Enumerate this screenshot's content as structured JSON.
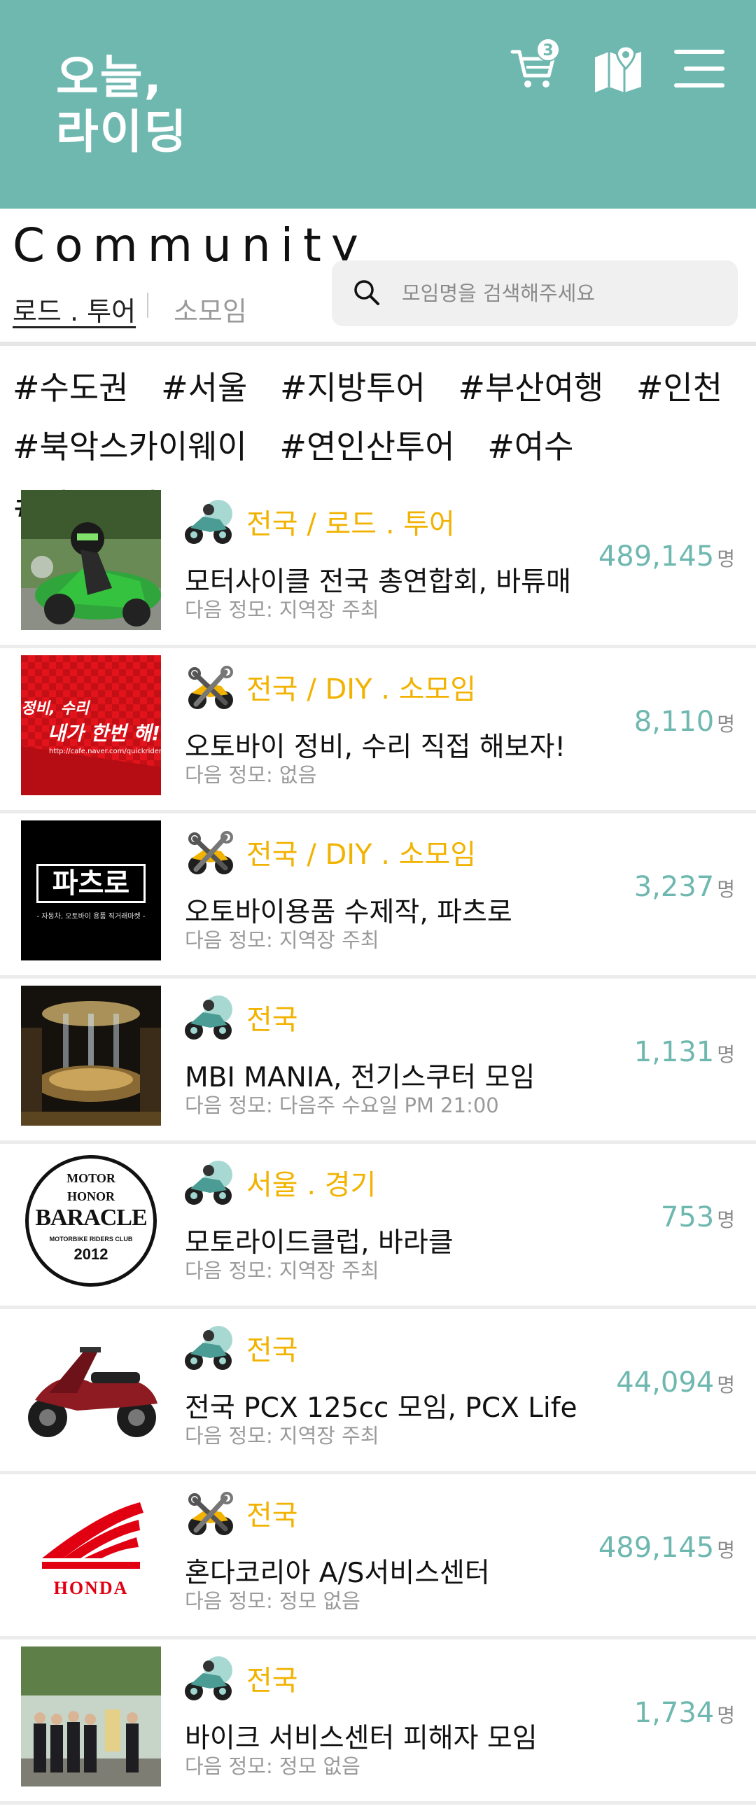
{
  "header": {
    "logo_line1": "오늘,",
    "logo_line2": "라이딩",
    "cart_count": "3",
    "colors": {
      "brand": "#6fb8b0",
      "accent": "#f2b200"
    }
  },
  "community": {
    "title": "Community",
    "tabs": [
      {
        "label": "로드 . 투어"
      },
      {
        "label": "소모임"
      }
    ],
    "search_placeholder": "모임명을 검색해주세요"
  },
  "tags": [
    "#수도권",
    "#서울",
    "#지방투어",
    "#부산여행",
    "#인천",
    "#북악스카이웨이",
    "#연인산투어",
    "#여수",
    "#커플투어"
  ],
  "unit": "명",
  "groups": [
    {
      "category": "전국 / 로드 . 투어",
      "name": "모터사이클 전국 총연합회, 바튜매",
      "next": "다음 정모: 지역장 주최",
      "count": "489,145",
      "icon": "motorcycle-icon",
      "thumb": "racer"
    },
    {
      "category": "전국  / DIY . 소모임",
      "name": "오토바이 정비, 수리 직접 해보자!",
      "next": "다음 정모: 없음",
      "count": "8,110",
      "icon": "tools-icon",
      "thumb": "repair",
      "thumb_text1": "정비, 수리",
      "thumb_text2": "내가 한번 해!",
      "thumb_url": "http://cafe.naver.com/quickrider"
    },
    {
      "category": "전국  / DIY . 소모임",
      "name": "오토바이용품 수제작, 파츠로",
      "next": "다음 정모: 지역장 주최",
      "count": "3,237",
      "icon": "tools-icon",
      "thumb": "partsro",
      "thumb_text1": "파츠로",
      "thumb_text2": "- 자동차, 오토바이 용품 직거래마켓 -"
    },
    {
      "category": "전국",
      "name": "MBI MANIA, 전기스쿠터 모임",
      "next": "다음 정모: 다음주 수요일 PM 21:00",
      "count": "1,131",
      "icon": "motorcycle-icon",
      "thumb": "stage"
    },
    {
      "category": "서울 . 경기",
      "name": "모토라이드클럽, 바라클",
      "next": "다음 정모: 지역장 주최",
      "count": "753",
      "icon": "motorcycle-icon",
      "thumb": "baracle",
      "thumb_text1": "MOTOR",
      "thumb_text2": "HONOR",
      "thumb_text3": "BARACLE",
      "thumb_text4": "MOTORBIKE RIDERS CLUB",
      "thumb_text5": "2012"
    },
    {
      "category": "전국",
      "name": "전국 PCX 125cc 모임, PCX Life",
      "next": "다음 정모: 지역장 주최",
      "count": "44,094",
      "icon": "motorcycle-icon",
      "thumb": "scooter"
    },
    {
      "category": "전국",
      "name": "혼다코리아 A/S서비스센터",
      "next": "다음 정모: 정모 없음",
      "count": "489,145",
      "icon": "tools-icon",
      "thumb": "honda",
      "thumb_text1": "HONDA"
    },
    {
      "category": "전국",
      "name": "바이크 서비스센터 피해자 모임",
      "next": "다음 정모: 정모 없음",
      "count": "1,734",
      "icon": "motorcycle-icon",
      "thumb": "people"
    }
  ]
}
